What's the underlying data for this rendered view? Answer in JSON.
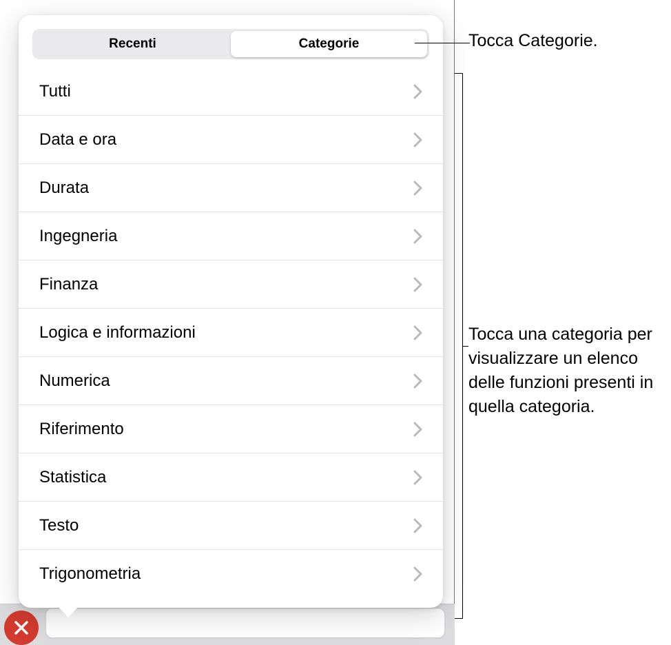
{
  "segmented": {
    "recent": "Recenti",
    "categories": "Categorie"
  },
  "list": {
    "items": [
      {
        "label": "Tutti"
      },
      {
        "label": "Data e ora"
      },
      {
        "label": "Durata"
      },
      {
        "label": "Ingegneria"
      },
      {
        "label": "Finanza"
      },
      {
        "label": "Logica e informazioni"
      },
      {
        "label": "Numerica"
      },
      {
        "label": "Riferimento"
      },
      {
        "label": "Statistica"
      },
      {
        "label": "Testo"
      },
      {
        "label": "Trigonometria"
      }
    ]
  },
  "callouts": {
    "tap_categories": "Tocca Categorie.",
    "tap_category_detail": "Tocca una categoria per visualizzare un elenco delle funzioni presenti in quella categoria."
  }
}
